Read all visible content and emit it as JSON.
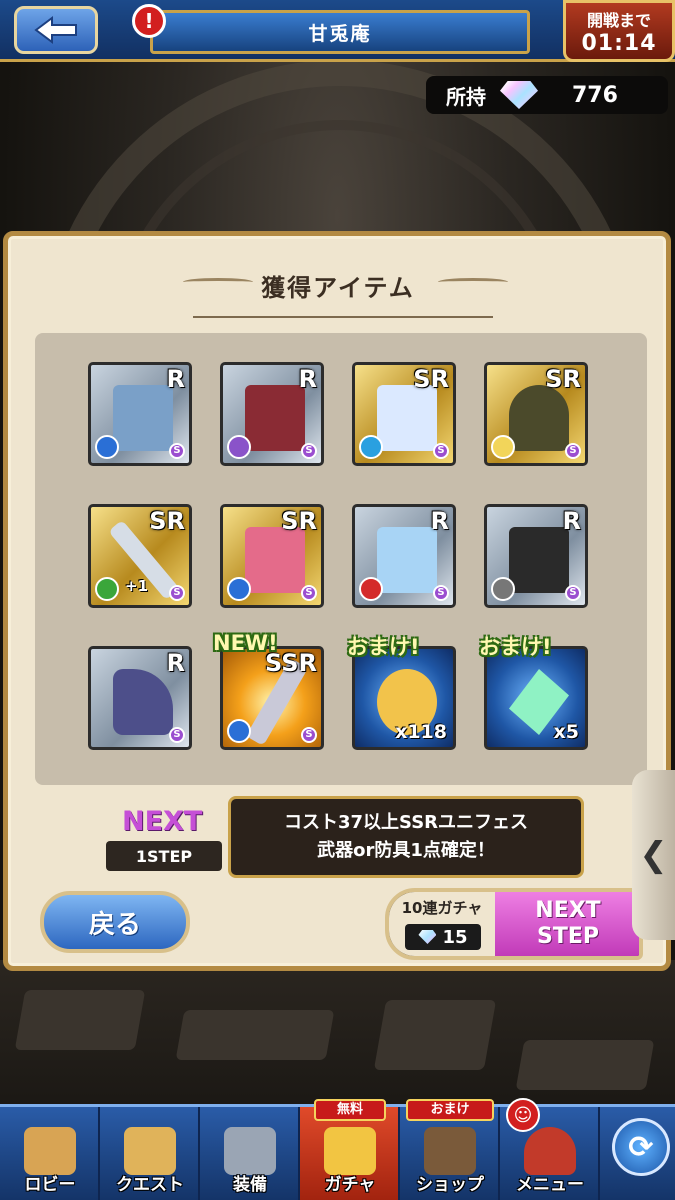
{
  "header": {
    "back_icon": "arrow-left-icon",
    "alert_icon": "!",
    "title": "甘兎庵",
    "timer_label": "開戦まで",
    "timer_value": "01:14"
  },
  "currency": {
    "label": "所持",
    "icon": "gem-icon",
    "value": "776"
  },
  "panel": {
    "title": "獲得アイテム",
    "items": [
      {
        "name": "armor-white-blue",
        "rarity": "R",
        "color": "#7aa0c8"
      },
      {
        "name": "scythe-red",
        "rarity": "R",
        "color": "#8a2b34"
      },
      {
        "name": "bow-white",
        "rarity": "SR",
        "color": "#dbe9ff"
      },
      {
        "name": "beret-olive",
        "rarity": "SR",
        "color": "#4b4a2b"
      },
      {
        "name": "sword-silver",
        "rarity": "SR",
        "color": "#d6dde6",
        "plus": "+1"
      },
      {
        "name": "ribbon-staff-pink",
        "rarity": "SR",
        "color": "#e46b8a"
      },
      {
        "name": "kimono-light-blue",
        "rarity": "R",
        "color": "#a8d4f5"
      },
      {
        "name": "armor-black-gold",
        "rarity": "R",
        "color": "#2a2a2a"
      },
      {
        "name": "witch-hat-purple",
        "rarity": "R",
        "color": "#4d4f8a"
      },
      {
        "name": "axe-ssr",
        "rarity": "SSR",
        "tag": "NEW!",
        "color": "#c9c9d8"
      },
      {
        "name": "medal-gold",
        "tag": "おまけ!",
        "qty": "x118",
        "color": "#f2c34b"
      },
      {
        "name": "crystal-green",
        "tag": "おまけ!",
        "qty": "x5",
        "color": "#8ff2c4"
      }
    ],
    "next_label": "NEXT",
    "step_label": "1STEP",
    "guarantee_line1": "コスト37以上SSRユニフェス",
    "guarantee_line2": "武器or防具1点確定！",
    "back_label": "戻る",
    "gacha_label": "10連ガチャ",
    "gacha_cost": "15",
    "next_step_line1": "NEXT",
    "next_step_line2": "STEP"
  },
  "side_tab": {
    "icon": "chevron-left-icon"
  },
  "bottom_nav": [
    {
      "label": "ロビー",
      "icon": "castle-icon"
    },
    {
      "label": "クエスト",
      "icon": "scroll-map-icon"
    },
    {
      "label": "装備",
      "icon": "armor-icon"
    },
    {
      "label": "ガチャ",
      "icon": "treasure-chest-icon",
      "badge": "無料"
    },
    {
      "label": "ショップ",
      "icon": "shop-icon",
      "badge": "おまけ"
    },
    {
      "label": "メニュー",
      "icon": "scroll-icon"
    }
  ],
  "colors": {
    "accent_gold": "#c9a24a",
    "nav_blue": "#2a5ca8",
    "next_purple": "#c54fd6",
    "step_pink": "#ee7fe3"
  }
}
